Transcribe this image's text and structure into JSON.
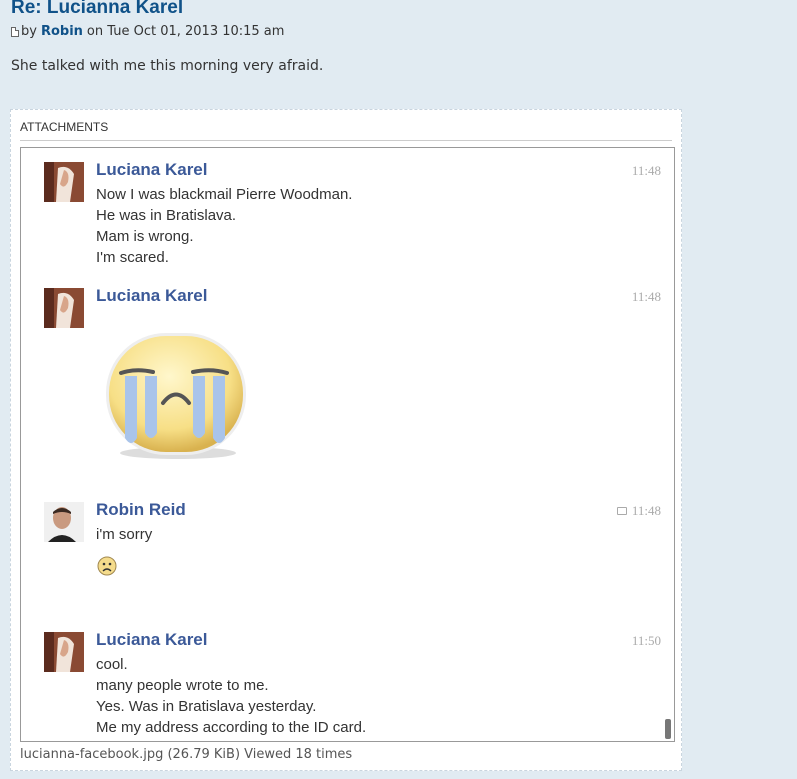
{
  "post": {
    "title": "Re: Lucianna Karel",
    "by_prefix": "by",
    "author": "Robin",
    "date": "on Tue Oct 01, 2013 10:15 am",
    "body": "She talked with me this morning very afraid."
  },
  "attachments": {
    "header": "ATTACHMENTS",
    "caption": "lucianna-facebook.jpg (26.79 KiB) Viewed 18 times"
  },
  "chat": {
    "messages": [
      {
        "name": "Luciana Karel",
        "time": "11:48",
        "lines": [
          "Now I was blackmail Pierre Woodman.",
          "He was in Bratislava.",
          "Mam is wrong.",
          "I'm scared."
        ]
      },
      {
        "name": "Luciana Karel",
        "time": "11:48",
        "sticker": "crying-face-sticker"
      },
      {
        "name": "Robin Reid",
        "time": "11:48",
        "lines": [
          "i'm sorry"
        ],
        "emoticon": "frown-emoticon"
      },
      {
        "name": "Luciana Karel",
        "time": "11:50",
        "lines": [
          "cool.",
          "many people wrote to me.",
          "Yes. Was in Bratislava yesterday.",
          "Me my address according to the ID card."
        ]
      }
    ]
  },
  "colors": {
    "page_bg": "#e1ebf2",
    "title": "#105289",
    "chat_name": "#3b5998"
  }
}
